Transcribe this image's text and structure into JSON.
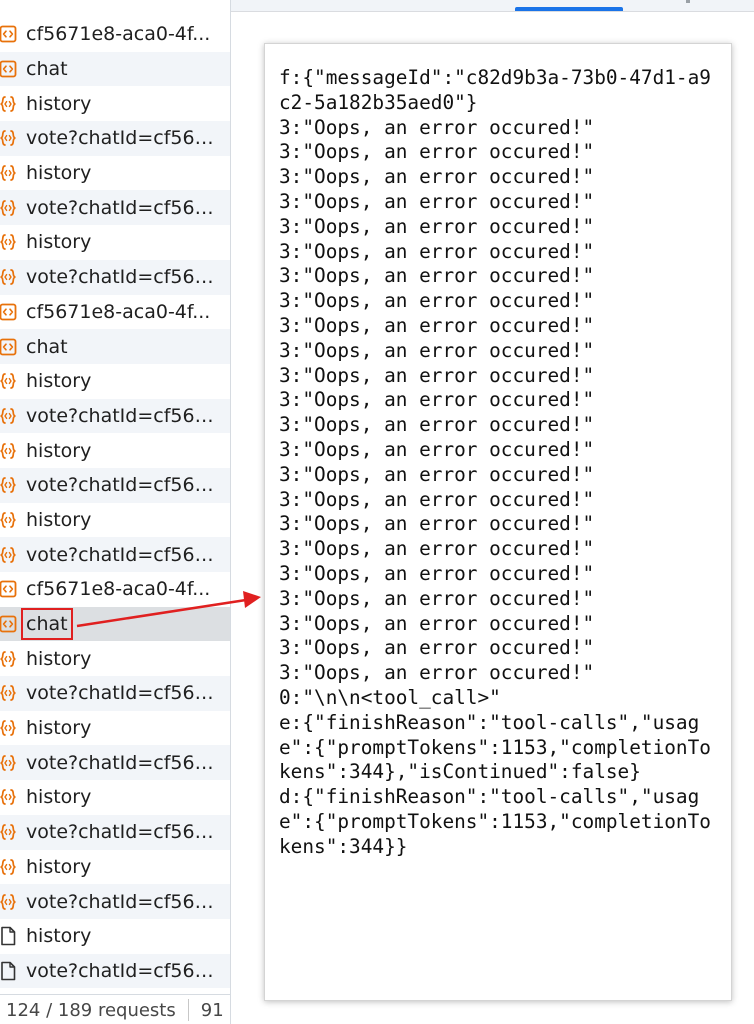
{
  "network": {
    "requests": [
      {
        "name": "cf5671e8-aca0-4f...",
        "icon": "document-code-icon",
        "type": "doc"
      },
      {
        "name": "chat",
        "icon": "document-code-icon",
        "type": "doc"
      },
      {
        "name": "history",
        "icon": "json-braces-icon",
        "type": "fetch"
      },
      {
        "name": "vote?chatId=cf567...",
        "icon": "json-braces-icon",
        "type": "fetch"
      },
      {
        "name": "history",
        "icon": "json-braces-icon",
        "type": "fetch"
      },
      {
        "name": "vote?chatId=cf567...",
        "icon": "json-braces-icon",
        "type": "fetch"
      },
      {
        "name": "history",
        "icon": "json-braces-icon",
        "type": "fetch"
      },
      {
        "name": "vote?chatId=cf567...",
        "icon": "json-braces-icon",
        "type": "fetch"
      },
      {
        "name": "cf5671e8-aca0-4f...",
        "icon": "document-code-icon",
        "type": "doc"
      },
      {
        "name": "chat",
        "icon": "document-code-icon",
        "type": "doc"
      },
      {
        "name": "history",
        "icon": "json-braces-icon",
        "type": "fetch"
      },
      {
        "name": "vote?chatId=cf567...",
        "icon": "json-braces-icon",
        "type": "fetch"
      },
      {
        "name": "history",
        "icon": "json-braces-icon",
        "type": "fetch"
      },
      {
        "name": "vote?chatId=cf567...",
        "icon": "json-braces-icon",
        "type": "fetch"
      },
      {
        "name": "history",
        "icon": "json-braces-icon",
        "type": "fetch"
      },
      {
        "name": "vote?chatId=cf567...",
        "icon": "json-braces-icon",
        "type": "fetch"
      },
      {
        "name": "cf5671e8-aca0-4f...",
        "icon": "document-code-icon",
        "type": "doc"
      },
      {
        "name": "chat",
        "icon": "document-code-icon",
        "type": "doc",
        "selected": true
      },
      {
        "name": "history",
        "icon": "json-braces-icon",
        "type": "fetch"
      },
      {
        "name": "vote?chatId=cf567...",
        "icon": "json-braces-icon",
        "type": "fetch"
      },
      {
        "name": "history",
        "icon": "json-braces-icon",
        "type": "fetch"
      },
      {
        "name": "vote?chatId=cf567...",
        "icon": "json-braces-icon",
        "type": "fetch"
      },
      {
        "name": "history",
        "icon": "json-braces-icon",
        "type": "fetch"
      },
      {
        "name": "vote?chatId=cf567...",
        "icon": "json-braces-icon",
        "type": "fetch"
      },
      {
        "name": "history",
        "icon": "json-braces-icon",
        "type": "fetch"
      },
      {
        "name": "vote?chatId=cf567...",
        "icon": "json-braces-icon",
        "type": "fetch"
      },
      {
        "name": "history",
        "icon": "blank-file-icon",
        "type": "other"
      },
      {
        "name": "vote?chatId=cf567...",
        "icon": "blank-file-icon",
        "type": "other"
      }
    ]
  },
  "status_bar": {
    "request_count": "124 / 189 requests",
    "transferred_truncated": "91"
  },
  "response": {
    "body": "f:{\"messageId\":\"c82d9b3a-73b0-47d1-a9c2-5a182b35aed0\"}\n3:\"Oops, an error occured!\"\n3:\"Oops, an error occured!\"\n3:\"Oops, an error occured!\"\n3:\"Oops, an error occured!\"\n3:\"Oops, an error occured!\"\n3:\"Oops, an error occured!\"\n3:\"Oops, an error occured!\"\n3:\"Oops, an error occured!\"\n3:\"Oops, an error occured!\"\n3:\"Oops, an error occured!\"\n3:\"Oops, an error occured!\"\n3:\"Oops, an error occured!\"\n3:\"Oops, an error occured!\"\n3:\"Oops, an error occured!\"\n3:\"Oops, an error occured!\"\n3:\"Oops, an error occured!\"\n3:\"Oops, an error occured!\"\n3:\"Oops, an error occured!\"\n3:\"Oops, an error occured!\"\n3:\"Oops, an error occured!\"\n3:\"Oops, an error occured!\"\n3:\"Oops, an error occured!\"\n3:\"Oops, an error occured!\"\n0:\"\\n\\n<tool_call>\"\ne:{\"finishReason\":\"tool-calls\",\"usage\":{\"promptTokens\":1153,\"completionTokens\":344},\"isContinued\":false}\nd:{\"finishReason\":\"tool-calls\",\"usage\":{\"promptTokens\":1153,\"completionTokens\":344}}"
  },
  "colors": {
    "icon_orange": "#e8710a",
    "selected_row": "#dcdfe2",
    "alt_row": "#f2f5f9",
    "annotation_red": "#e02020",
    "tab_blue": "#1a73e8"
  }
}
